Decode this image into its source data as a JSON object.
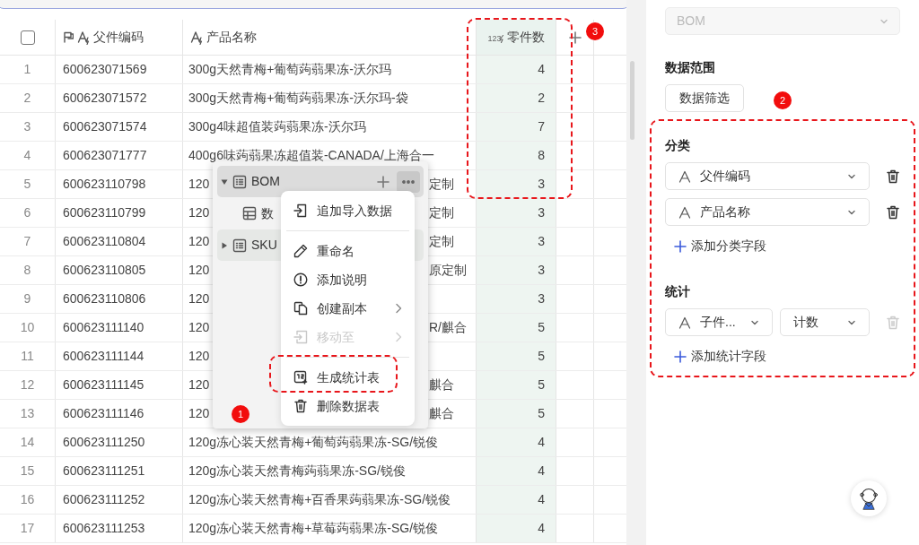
{
  "table": {
    "select_all_checked": false,
    "columns": [
      {
        "label": "父件编码",
        "kind": "text",
        "primary": true
      },
      {
        "label": "产品名称",
        "kind": "text",
        "primary": false
      },
      {
        "label": "零件数",
        "kind": "number",
        "type_label": "123",
        "highlighted": true
      }
    ],
    "rows": [
      {
        "index": "1",
        "code": "600623071569",
        "product": {
          "head": "300g天然青梅+葡萄蒟蒻果冻-沃尔玛"
        },
        "count": "4"
      },
      {
        "index": "2",
        "code": "600623071572",
        "product": {
          "head": "300g天然青梅+葡萄蒟蒻果冻-沃尔玛-袋"
        },
        "count": "2"
      },
      {
        "index": "3",
        "code": "600623071574",
        "product": {
          "head": "300g4味超值装蒟蒻果冻-沃尔玛"
        },
        "count": "7"
      },
      {
        "index": "4",
        "code": "600623071777",
        "product": {
          "head": "400g6味蒟蒻果冻超值装-CANADA/上海合一"
        },
        "count": "8"
      },
      {
        "index": "5",
        "code": "600623110798",
        "product": {
          "head": "120",
          "tail": "定制"
        },
        "count": "3"
      },
      {
        "index": "6",
        "code": "600623110799",
        "product": {
          "head": "120",
          "tail": "定制"
        },
        "count": "3"
      },
      {
        "index": "7",
        "code": "600623110804",
        "product": {
          "head": "120",
          "tail": "定制"
        },
        "count": "3"
      },
      {
        "index": "8",
        "code": "600623110805",
        "product": {
          "head": "120",
          "tail": "原定制"
        },
        "count": "3"
      },
      {
        "index": "9",
        "code": "600623110806",
        "product": {
          "head": "120"
        },
        "count": "3"
      },
      {
        "index": "10",
        "code": "600623111140",
        "product": {
          "head": "120",
          "tail": "R/麒合"
        },
        "count": "5"
      },
      {
        "index": "11",
        "code": "600623111144",
        "product": {
          "head": "120"
        },
        "count": "5"
      },
      {
        "index": "12",
        "code": "600623111145",
        "product": {
          "head": "120",
          "tail": "麒合"
        },
        "count": "5"
      },
      {
        "index": "13",
        "code": "600623111146",
        "product": {
          "head": "120",
          "tail": "麒合"
        },
        "count": "5"
      },
      {
        "index": "14",
        "code": "600623111250",
        "product": {
          "head": "120g冻心装天然青梅+葡萄蒟蒻果冻-SG/锐俊"
        },
        "count": "4"
      },
      {
        "index": "15",
        "code": "600623111251",
        "product": {
          "head": "120g冻心装天然青梅蒟蒻果冻-SG/锐俊"
        },
        "count": "4"
      },
      {
        "index": "16",
        "code": "600623111252",
        "product": {
          "head": "120g冻心装天然青梅+百香果蒟蒻果冻-SG/锐俊"
        },
        "count": "4"
      },
      {
        "index": "17",
        "code": "600623111253",
        "product": {
          "head": "120g冻心装天然青梅+草莓蒟蒻果冻-SG/锐俊"
        },
        "count": "4"
      }
    ]
  },
  "tree_popup": {
    "items": [
      {
        "label": "BOM",
        "expanded": true,
        "selected": true,
        "children": [
          {
            "label": "数"
          }
        ]
      },
      {
        "label": "SKU",
        "expanded": false,
        "selected": false
      }
    ]
  },
  "context_menu": [
    {
      "kind": "import",
      "label": "追加导入数据",
      "disabled": false,
      "submenu": false
    },
    {
      "kind": "divider"
    },
    {
      "kind": "rename",
      "label": "重命名",
      "disabled": false,
      "submenu": false
    },
    {
      "kind": "info",
      "label": "添加说明",
      "disabled": false,
      "submenu": false
    },
    {
      "kind": "copy",
      "label": "创建副本",
      "disabled": false,
      "submenu": true
    },
    {
      "kind": "move",
      "label": "移动至",
      "disabled": true,
      "submenu": true
    },
    {
      "kind": "divider"
    },
    {
      "kind": "stats",
      "label": "生成统计表",
      "disabled": false,
      "submenu": false
    },
    {
      "kind": "delete",
      "label": "删除数据表",
      "disabled": false,
      "submenu": false
    }
  ],
  "side_panel": {
    "source_select": {
      "value": "BOM",
      "disabled": true
    },
    "data_range": {
      "title": "数据范围",
      "button": "数据筛选"
    },
    "group": {
      "title": "分类",
      "fields": [
        "父件编码",
        "产品名称"
      ],
      "add": "添加分类字段"
    },
    "stats": {
      "title": "统计",
      "field": "子件...",
      "method": "计数",
      "delete_disabled": true,
      "add": "添加统计字段"
    }
  },
  "annotations": [
    "1",
    "2",
    "3"
  ]
}
